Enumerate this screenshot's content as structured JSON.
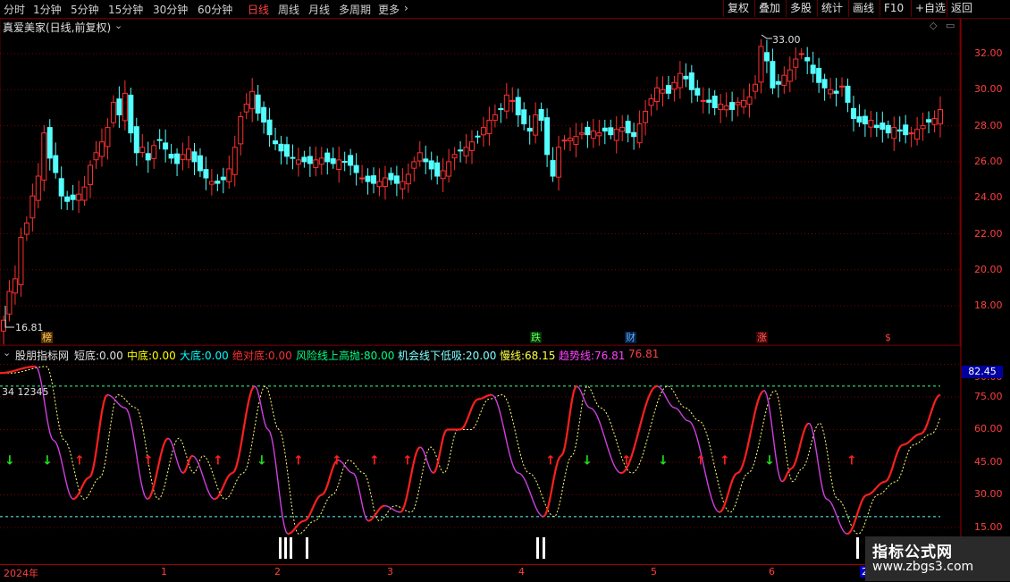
{
  "toolbar": {
    "periods": [
      "分时",
      "1分钟",
      "5分钟",
      "15分钟",
      "30分钟",
      "60分钟",
      "日线",
      "周线",
      "月线",
      "多周期",
      "更多"
    ],
    "active_period": "日线",
    "right_buttons": [
      "复权",
      "叠加",
      "多股",
      "统计",
      "画线",
      "F10",
      "+自选",
      "返回"
    ]
  },
  "stock_title": "真爱美家(日线,前复权)",
  "price_axis": [
    "32.00",
    "30.00",
    "28.00",
    "26.00",
    "24.00",
    "22.00",
    "20.00",
    "18.00"
  ],
  "price_high_label": "33.00",
  "price_low_label": "16.81",
  "events": [
    {
      "text": "榜",
      "color": "#ffcc66"
    },
    {
      "text": "跌",
      "color": "#66ff66"
    },
    {
      "text": "财",
      "color": "#66aaff"
    },
    {
      "text": "涨",
      "color": "#ff6666"
    },
    {
      "text": "$",
      "color": "#ff4040"
    }
  ],
  "indicator": {
    "name": "股朋指标网",
    "items": [
      {
        "label": "短底:",
        "value": "0.00",
        "color": "#e0e0e0"
      },
      {
        "label": "中底:",
        "value": "0.00",
        "color": "#ffff00"
      },
      {
        "label": "大底:",
        "value": "0.00",
        "color": "#00ffff"
      },
      {
        "label": "绝对底:",
        "value": "0.00",
        "color": "#ff3030"
      },
      {
        "label": "风险线上高抛:",
        "value": "80.00",
        "color": "#00ff80"
      },
      {
        "label": "机会线下低吸:",
        "value": "20.00",
        "color": "#80ffff"
      },
      {
        "label": "慢线:",
        "value": "68.15",
        "color": "#ffff40"
      },
      {
        "label": "趋势线:",
        "value": "76.81",
        "color": "#ff40ff"
      },
      {
        "label": "",
        "value": "76.81",
        "color": "#ff4040"
      }
    ],
    "axis": [
      "90.00",
      "75.00",
      "60.00",
      "45.00",
      "30.00",
      "15.00"
    ],
    "current_value": "82.45",
    "left_counter": "34  12345"
  },
  "xaxis": [
    "2024年",
    "1",
    "2",
    "3",
    "4",
    "5",
    "6",
    "2"
  ],
  "watermark": {
    "title": "指标公式网",
    "url": "www.zbgs3.com"
  }
}
